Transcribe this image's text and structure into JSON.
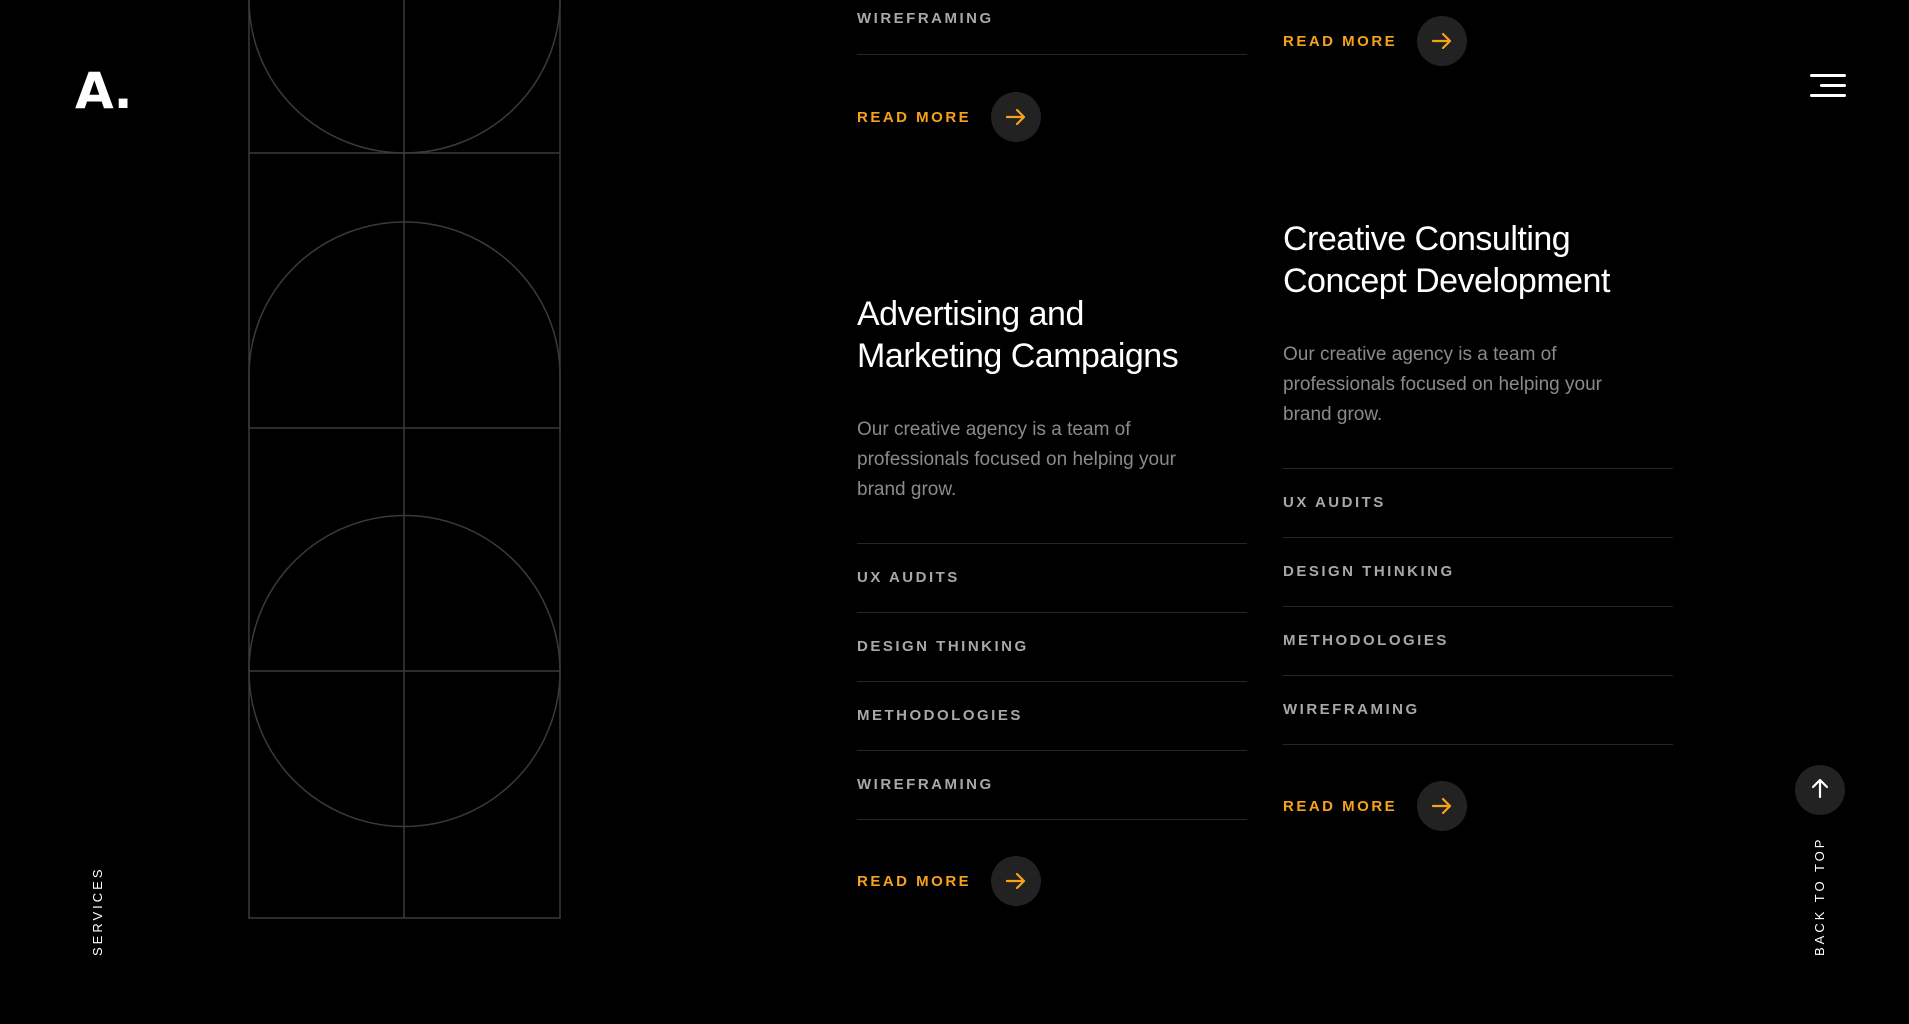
{
  "header": {
    "logo": "A.",
    "menu_icon": "hamburger-icon"
  },
  "section_label": "SERVICES",
  "top_left": {
    "partial_tag": "WIREFRAMING",
    "read_more": "READ MORE"
  },
  "top_right": {
    "read_more": "READ MORE"
  },
  "cards": [
    {
      "title_line1": "Advertising and",
      "title_line2": "Marketing Campaigns",
      "description": "Our creative agency is a team of professionals focused on helping your brand grow.",
      "tags": [
        "UX AUDITS",
        "DESIGN THINKING",
        "METHODOLOGIES",
        "WIREFRAMING"
      ],
      "read_more": "READ MORE"
    },
    {
      "title_line1": "Creative Consulting",
      "title_line2": "Concept Development",
      "description": "Our creative agency is a team of professionals focused on helping your brand grow.",
      "tags": [
        "UX AUDITS",
        "DESIGN THINKING",
        "METHODOLOGIES",
        "WIREFRAMING"
      ],
      "read_more": "READ MORE"
    }
  ],
  "back_to_top": "BACK TO TOP",
  "colors": {
    "accent": "#f7a21b",
    "background": "#000000",
    "muted_text": "#8a8a8a",
    "line": "#262626"
  }
}
